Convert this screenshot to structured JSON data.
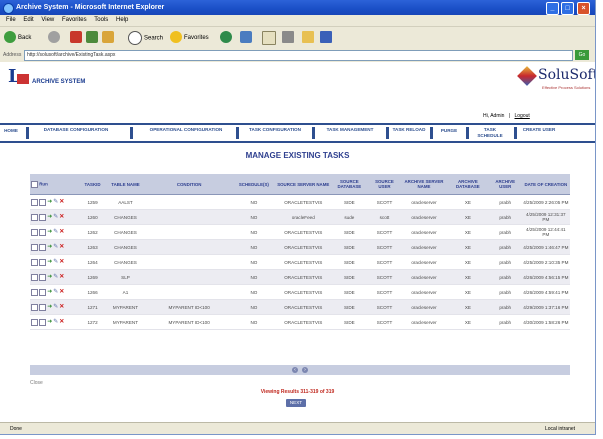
{
  "window": {
    "title": "Archive System - Microsoft Internet Explorer",
    "minimize": "_",
    "maximize": "□",
    "close": "×"
  },
  "menu": [
    "File",
    "Edit",
    "View",
    "Favorites",
    "Tools",
    "Help"
  ],
  "toolbar": {
    "back": "Back",
    "search": "Search",
    "favorites": "Favorites"
  },
  "address": {
    "label": "Address",
    "url": "http://solusoft/archive/ExistingTask.aspx",
    "go": "Go"
  },
  "header": {
    "system_name": "ARCHIVE SYSTEM",
    "brand_name": "SoluSoft",
    "brand_tagline": "Effective Process Solutions",
    "user": "Hi, Admin",
    "logout": "Logout"
  },
  "nav": [
    "HOME",
    "DATABASE CONFIGURATION",
    "OPERATIONAL CONFIGURATION",
    "TASK CONFIGURATION",
    "TASK MANAGEMENT",
    "TASK RELOAD",
    "PURGE",
    "TASK SCHEDULE",
    "CREATE USER"
  ],
  "page_title": "MANAGE EXISTING TASKS",
  "table": {
    "columns": [
      "Run",
      "TASKID",
      "TABLE NAME",
      "CONDITION",
      "SCHEDULE(S)",
      "SOURCE SERVER NAME",
      "SOURCE DATABASE",
      "SOURCE USER",
      "ARCHIVE SERVER NAME",
      "ARCHIVE DATABASE",
      "ARCHIVE USER",
      "DATE OF CREATION"
    ],
    "rows": [
      [
        "1259",
        "AALST",
        "",
        "NO",
        "ORACLETESTVIS",
        "SIDE",
        "SCOTT",
        "oracleserver",
        "XE",
        "prabh",
        "4/25/2009 2:26:05 PM"
      ],
      [
        "1260",
        "CHANGES",
        "",
        "NO",
        "oracleFeed",
        "sude",
        "scott",
        "oracleserver",
        "XE",
        "prabh",
        "4/25/2009 12:31:37 PM"
      ],
      [
        "1262",
        "CHANGES",
        "",
        "NO",
        "ORACLETESTVIS",
        "SIDE",
        "SCOTT",
        "oracleserver",
        "XE",
        "prabh",
        "4/25/2009 12:44:41 PM"
      ],
      [
        "1263",
        "CHANGES",
        "",
        "NO",
        "ORACLETESTVIS",
        "SIDE",
        "SCOTT",
        "oracleserver",
        "XE",
        "prabh",
        "4/25/2009 1:46:47 PM"
      ],
      [
        "1264",
        "CHANGES",
        "",
        "NO",
        "ORACLETESTVIS",
        "SIDE",
        "SCOTT",
        "oracleserver",
        "XE",
        "prabh",
        "4/25/2009 2:10:35 PM"
      ],
      [
        "1269",
        "SLP",
        "",
        "NO",
        "ORACLETESTVIS",
        "SIDE",
        "SCOTT",
        "oracleserver",
        "XE",
        "prabh",
        "4/26/2009 4:56:15 PM"
      ],
      [
        "1266",
        "A1",
        "",
        "NO",
        "ORACLETESTVIS",
        "SIDE",
        "SCOTT",
        "oracleserver",
        "XE",
        "prabh",
        "4/26/2009 4:59:41 PM"
      ],
      [
        "1271",
        "MYPARENT",
        "MYPARENT ID<100",
        "NO",
        "ORACLETESTVIS",
        "SIDE",
        "SCOTT",
        "oracleserver",
        "XE",
        "prabh",
        "4/29/2009 1:37:16 PM"
      ],
      [
        "1272",
        "MYPARENT",
        "MYPARENT ID<100",
        "NO",
        "ORACLETESTVIS",
        "SIDE",
        "SCOTT",
        "oracleserver",
        "XE",
        "prabh",
        "4/30/2009 1:58:26 PM"
      ]
    ]
  },
  "pager": {
    "first": "1",
    "next": "2"
  },
  "close_label": "Close",
  "results_text": "Viewing Results 311-319 of 319",
  "next_button": "NEXT",
  "status": {
    "left": "Done",
    "zone": "Local intranet"
  },
  "colors": {
    "nav_blue": "#2e4f8f",
    "header_bg": "#c7cde0",
    "delete_red": "#cc1f1f",
    "run_green": "#2e8b2e"
  }
}
